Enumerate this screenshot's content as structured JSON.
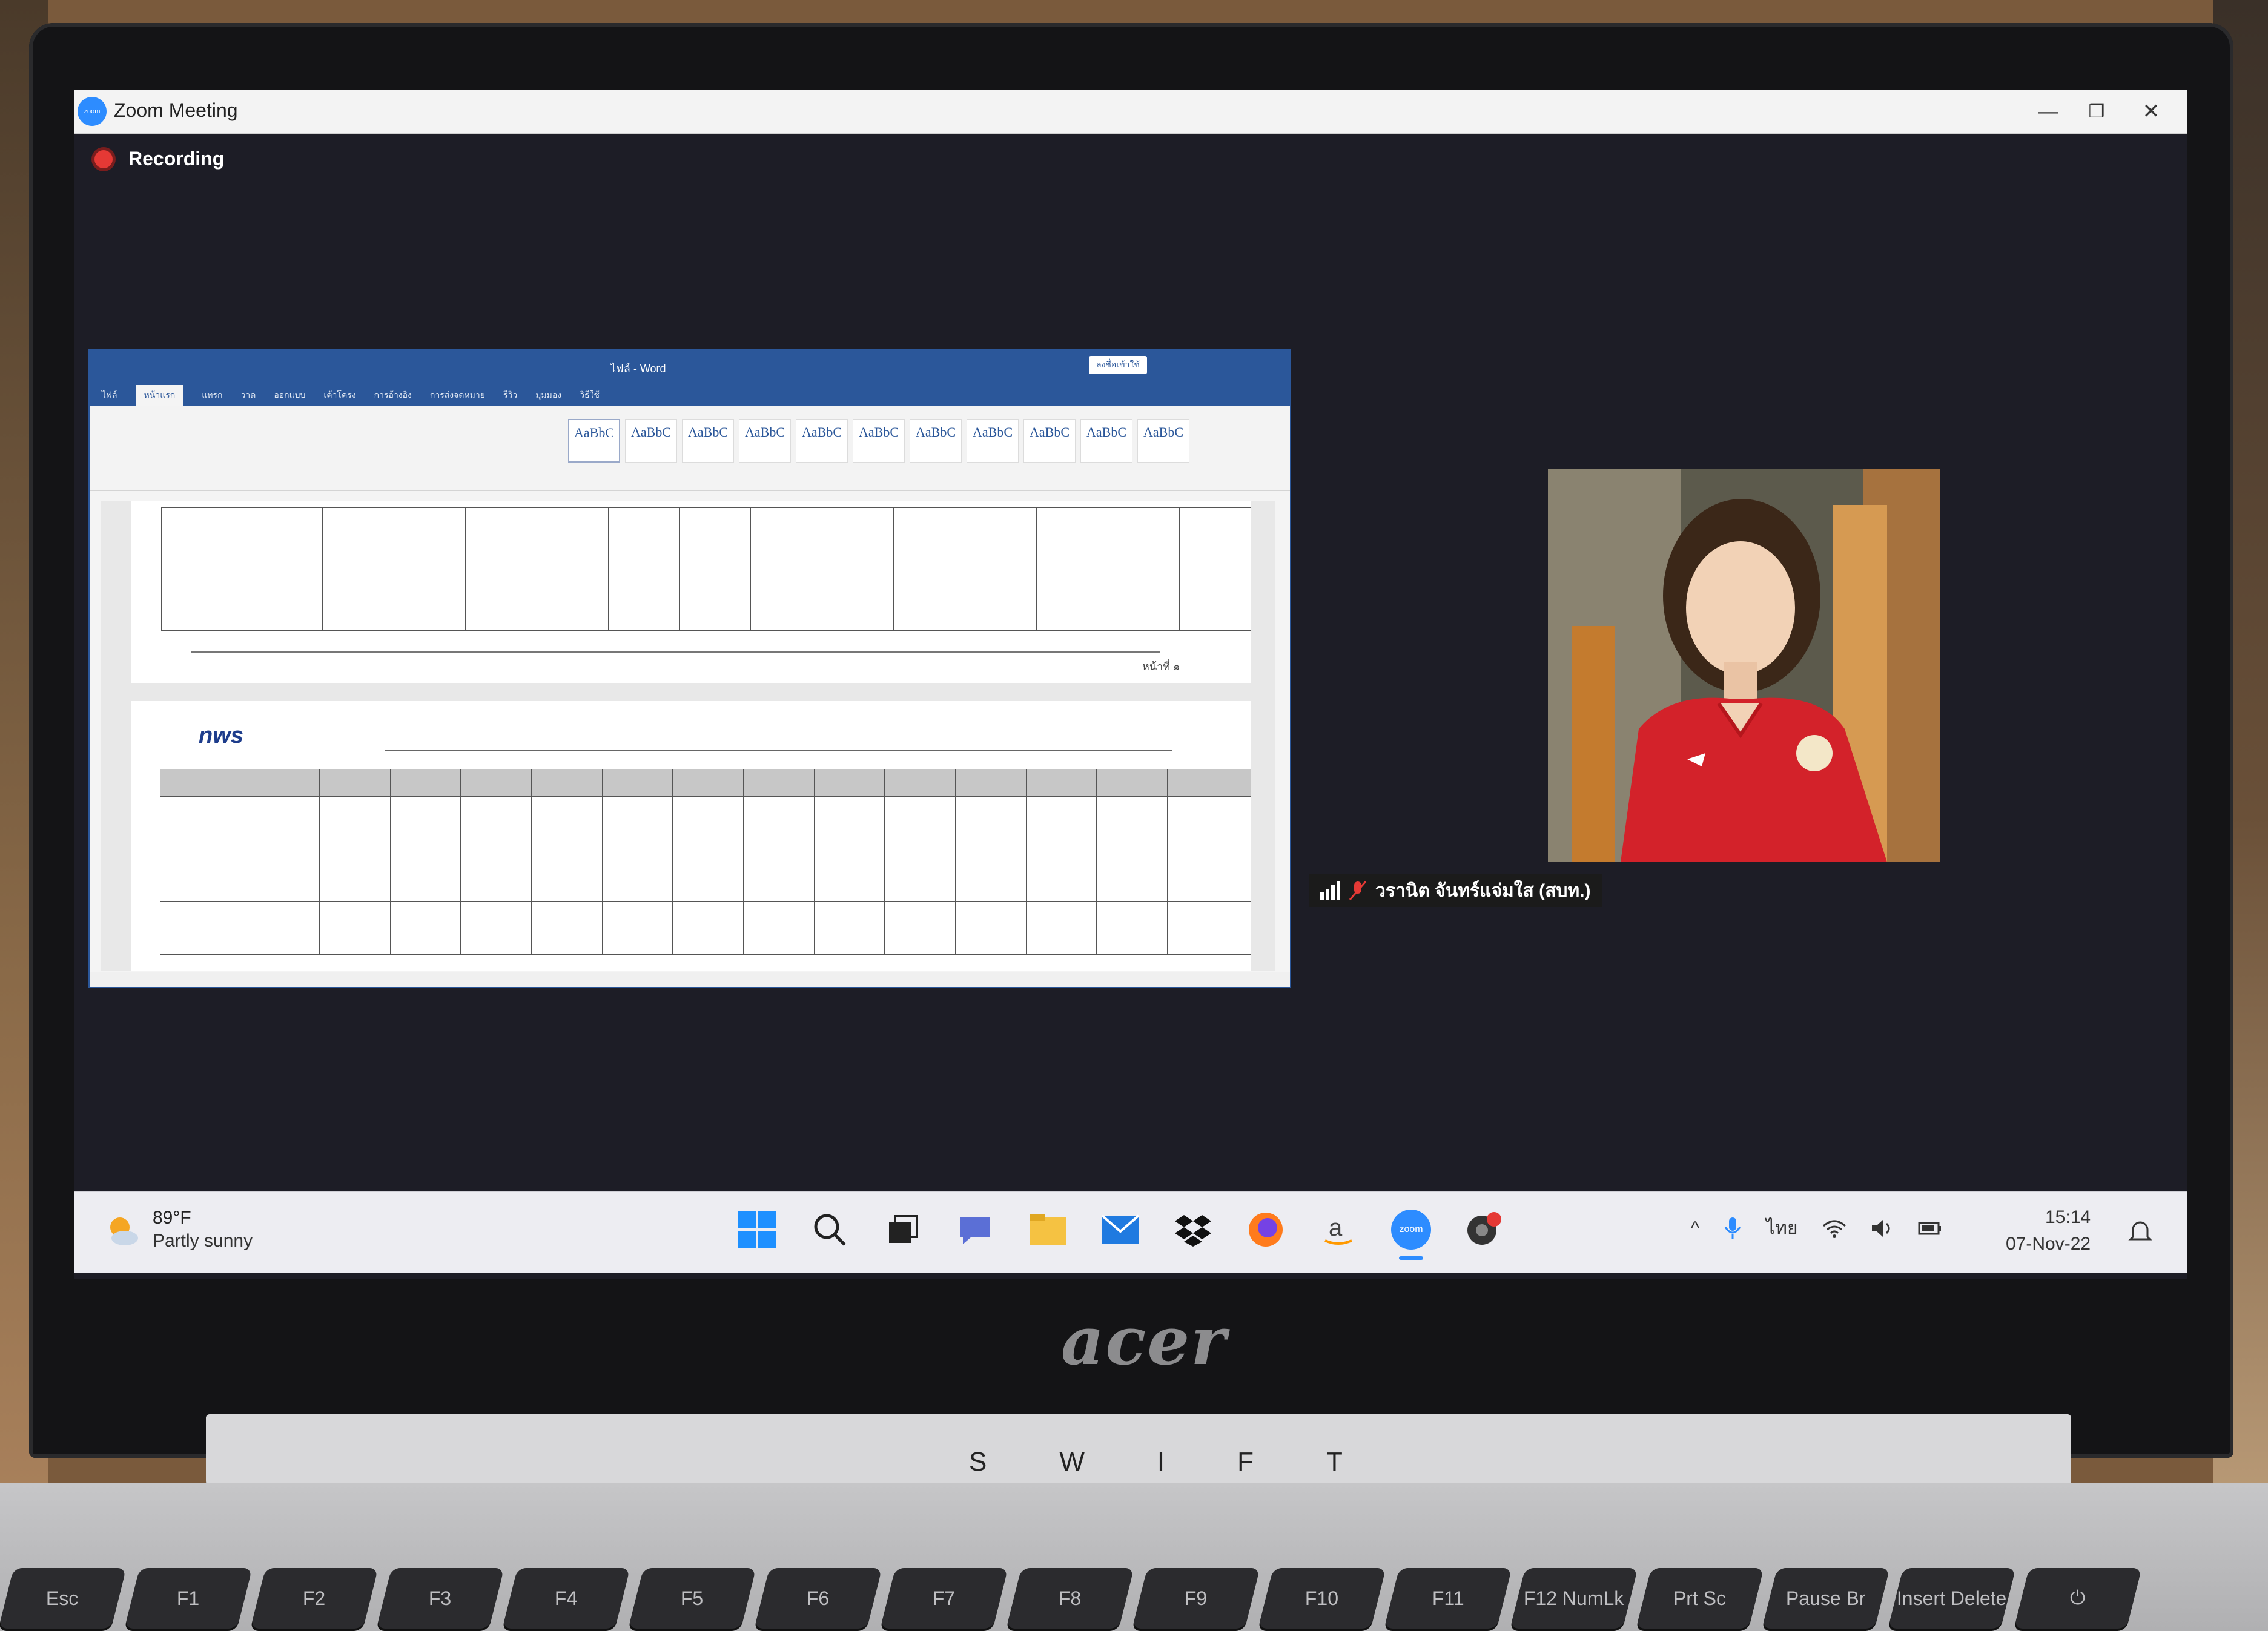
{
  "zoom": {
    "window_title": "Zoom Meeting",
    "recording_label": "Recording",
    "window_controls": {
      "minimize": "—",
      "restore": "❐",
      "close": "✕"
    }
  },
  "word": {
    "title": "ไฟล์ - Word",
    "signin_label": "ลงชื่อเข้าใช้",
    "tabs": [
      "ไฟล์",
      "หน้าแรก",
      "แทรก",
      "วาด",
      "ออกแบบ",
      "เค้าโครง",
      "การอ้างอิง",
      "การส่งจดหมาย",
      "รีวิว",
      "มุมมอง",
      "วิธีใช้"
    ],
    "style_label": "AaBbC",
    "logo_text": "nws",
    "page_number": "หน้าที่ ๑"
  },
  "participant": {
    "name": "วรานิต จันทร์แจ่มใส (สบท.)",
    "mic_muted": true
  },
  "taskbar": {
    "weather_temp": "89°F",
    "weather_desc": "Partly sunny",
    "language": "ไทย",
    "time": "15:14",
    "date": "07-Nov-22",
    "icons": [
      "windows-start-icon",
      "search-icon",
      "task-view-icon",
      "chat-icon",
      "file-explorer-icon",
      "mail-icon",
      "dropbox-icon",
      "firefox-icon",
      "amazon-icon",
      "zoom-icon",
      "recorder-icon"
    ],
    "zoom_icon_label": "zoom"
  },
  "laptop": {
    "brand": "acer",
    "model_letters": [
      "S",
      "W",
      "I",
      "F",
      "T"
    ],
    "keys": [
      "Esc",
      "F1",
      "F2",
      "F3",
      "F4",
      "F5",
      "F6",
      "F7",
      "F8",
      "F9",
      "F10",
      "F11",
      "F12 NumLk",
      "Prt Sc",
      "Pause Br",
      "Insert Delete",
      "⏻"
    ]
  },
  "colors": {
    "zoom_blue": "#2d8cff",
    "word_blue": "#2b579a",
    "recording_red": "#e53935",
    "screen_bg": "#1d1d26",
    "shirt_red": "#d3222a"
  }
}
